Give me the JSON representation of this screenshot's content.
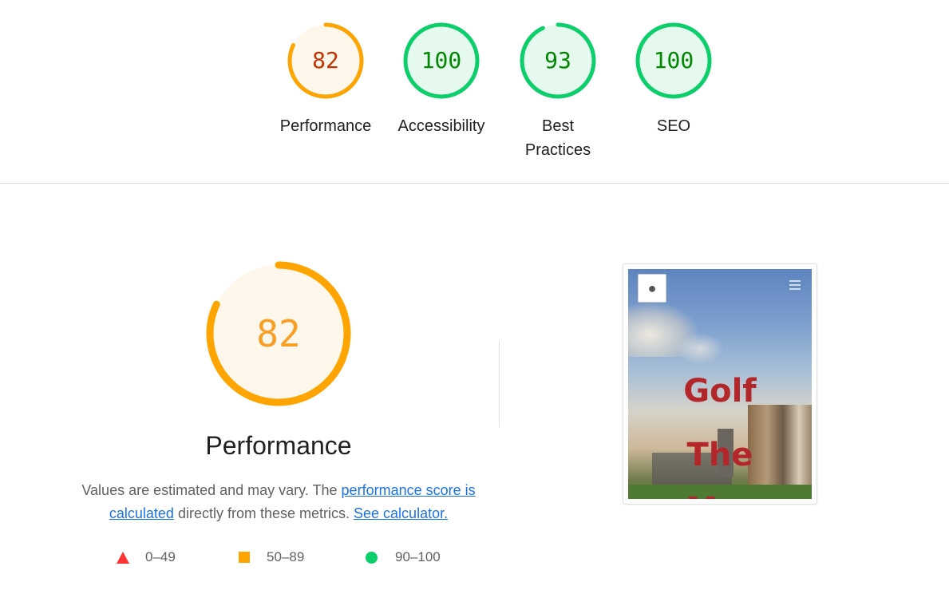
{
  "categories": [
    {
      "name": "performance",
      "score": 82,
      "label": "Performance",
      "status": "average"
    },
    {
      "name": "accessibility",
      "score": 100,
      "label": "Accessibility",
      "status": "pass"
    },
    {
      "name": "best-practices",
      "score": 93,
      "label": "Best Practices",
      "status": "pass"
    },
    {
      "name": "seo",
      "score": 100,
      "label": "SEO",
      "status": "pass"
    }
  ],
  "colors": {
    "average_ring": "#ffa400",
    "average_fill": "#fff7eb",
    "average_text": "#c33300",
    "pass_ring": "#0cce6b",
    "pass_fill": "#e6f9ee",
    "pass_text": "#008800",
    "fail": "#ff3333",
    "link": "#1a73e8"
  },
  "detail": {
    "score": "82",
    "score_value": 82,
    "title": "Performance",
    "desc_prefix": "Values are estimated and may vary. The ",
    "desc_link1": "performance score is calculated",
    "desc_middle": " directly from these metrics. ",
    "desc_link2": "See calculator."
  },
  "legend": [
    {
      "shape": "triangle-icon",
      "range": "0–49"
    },
    {
      "shape": "square-icon",
      "range": "50–89"
    },
    {
      "shape": "circle-icon",
      "range": "90–100"
    }
  ],
  "screenshot": {
    "logo_icon": "golf-ball-icon",
    "menu_icon": "hamburger-menu-icon",
    "hero_line1": "Golf",
    "hero_line2": "The",
    "hero_line3": "M..."
  }
}
